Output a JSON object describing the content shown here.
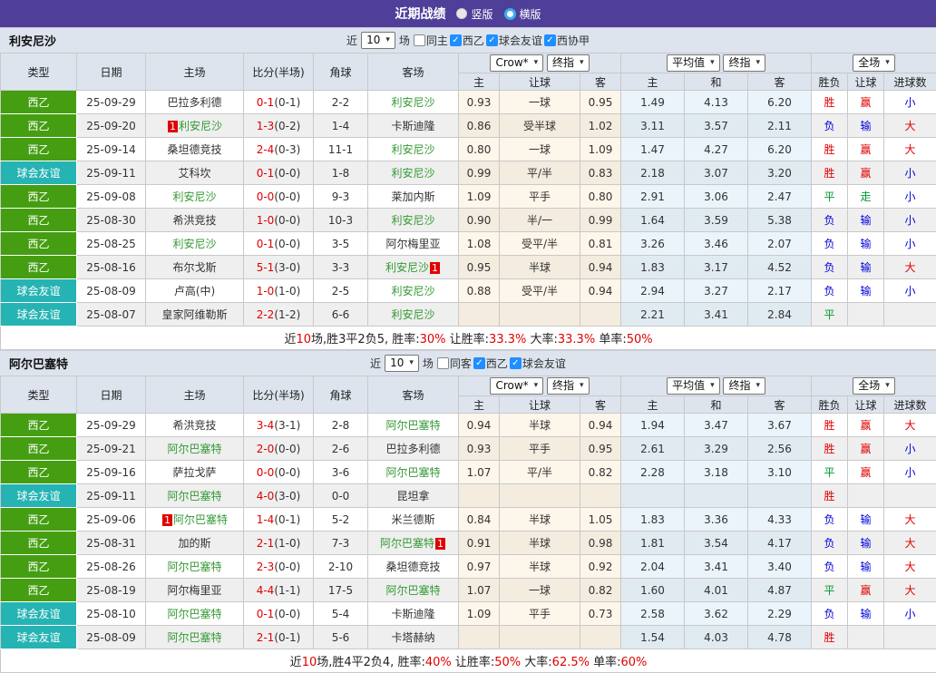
{
  "titlebar": {
    "title": "近期战绩",
    "layout_options": [
      {
        "label": "竖版",
        "style": "filled"
      },
      {
        "label": "横版",
        "style": "ring"
      }
    ]
  },
  "colors": {
    "header_purple": "#4f3f99",
    "league_green": "#459e12",
    "friendly_teal": "#26b3b3",
    "red": "#e00000",
    "blue": "#0000dd",
    "green": "#009933",
    "focus_team_green": "#339933"
  },
  "table_header": {
    "main_cols": [
      "类型",
      "日期",
      "主场",
      "比分(半场)",
      "角球",
      "客场"
    ],
    "odds_selects": [
      "Crow*",
      "终指"
    ],
    "avg_selects": [
      "平均值",
      "终指"
    ],
    "scope_select": "全场",
    "sub_cols": [
      "主",
      "让球",
      "客",
      "主",
      "和",
      "客",
      "胜负",
      "让球",
      "进球数"
    ]
  },
  "tables": [
    {
      "team": "利安尼沙",
      "filter": {
        "prefix": "近",
        "matches": "10",
        "suffix": "场",
        "same": {
          "label": "同主",
          "checked": false
        },
        "leagues": [
          {
            "label": "西乙",
            "checked": true
          },
          {
            "label": "球会友谊",
            "checked": true
          },
          {
            "label": "西协甲",
            "checked": true
          }
        ]
      },
      "rows": [
        {
          "type": "西乙",
          "tc": "g",
          "date": "25-09-29",
          "home": {
            "n": "巴拉多利德",
            "f": false
          },
          "score": "0-1",
          "half": "(0-1)",
          "corner": "2-2",
          "away": {
            "n": "利安尼沙",
            "f": true
          },
          "odds": [
            "0.93",
            "一球",
            "0.95"
          ],
          "avg": [
            "1.49",
            "4.13",
            "6.20"
          ],
          "res": [
            [
              "胜",
              "r"
            ],
            [
              "赢",
              "r"
            ],
            [
              "小",
              "b"
            ]
          ]
        },
        {
          "type": "西乙",
          "tc": "g",
          "date": "25-09-20",
          "home": {
            "n": "利安尼沙",
            "f": true,
            "pre": "1"
          },
          "score": "1-3",
          "half": "(0-2)",
          "corner": "1-4",
          "away": {
            "n": "卡斯迪隆",
            "f": false
          },
          "odds": [
            "0.86",
            "受半球",
            "1.02"
          ],
          "avg": [
            "3.11",
            "3.57",
            "2.11"
          ],
          "res": [
            [
              "负",
              "b"
            ],
            [
              "输",
              "b"
            ],
            [
              "大",
              "r"
            ]
          ]
        },
        {
          "type": "西乙",
          "tc": "g",
          "date": "25-09-14",
          "home": {
            "n": "桑坦德竞技",
            "f": false
          },
          "score": "2-4",
          "half": "(0-3)",
          "corner": "11-1",
          "away": {
            "n": "利安尼沙",
            "f": true
          },
          "odds": [
            "0.80",
            "一球",
            "1.09"
          ],
          "avg": [
            "1.47",
            "4.27",
            "6.20"
          ],
          "res": [
            [
              "胜",
              "r"
            ],
            [
              "赢",
              "r"
            ],
            [
              "大",
              "r"
            ]
          ]
        },
        {
          "type": "球会友谊",
          "tc": "t",
          "date": "25-09-11",
          "home": {
            "n": "艾科坎",
            "f": false
          },
          "score": "0-1",
          "half": "(0-0)",
          "corner": "1-8",
          "away": {
            "n": "利安尼沙",
            "f": true
          },
          "odds": [
            "0.99",
            "平/半",
            "0.83"
          ],
          "avg": [
            "2.18",
            "3.07",
            "3.20"
          ],
          "res": [
            [
              "胜",
              "r"
            ],
            [
              "赢",
              "r"
            ],
            [
              "小",
              "b"
            ]
          ]
        },
        {
          "type": "西乙",
          "tc": "g",
          "date": "25-09-08",
          "home": {
            "n": "利安尼沙",
            "f": true
          },
          "score": "0-0",
          "half": "(0-0)",
          "corner": "9-3",
          "away": {
            "n": "莱加内斯",
            "f": false
          },
          "odds": [
            "1.09",
            "平手",
            "0.80"
          ],
          "avg": [
            "2.91",
            "3.06",
            "2.47"
          ],
          "res": [
            [
              "平",
              "gr"
            ],
            [
              "走",
              "gr"
            ],
            [
              "小",
              "b"
            ]
          ]
        },
        {
          "type": "西乙",
          "tc": "g",
          "date": "25-08-30",
          "home": {
            "n": "希洪竞技",
            "f": false
          },
          "score": "1-0",
          "half": "(0-0)",
          "corner": "10-3",
          "away": {
            "n": "利安尼沙",
            "f": true
          },
          "odds": [
            "0.90",
            "半/一",
            "0.99"
          ],
          "avg": [
            "1.64",
            "3.59",
            "5.38"
          ],
          "res": [
            [
              "负",
              "b"
            ],
            [
              "输",
              "b"
            ],
            [
              "小",
              "b"
            ]
          ]
        },
        {
          "type": "西乙",
          "tc": "g",
          "date": "25-08-25",
          "home": {
            "n": "利安尼沙",
            "f": true
          },
          "score": "0-1",
          "half": "(0-0)",
          "corner": "3-5",
          "away": {
            "n": "阿尔梅里亚",
            "f": false
          },
          "odds": [
            "1.08",
            "受平/半",
            "0.81"
          ],
          "avg": [
            "3.26",
            "3.46",
            "2.07"
          ],
          "res": [
            [
              "负",
              "b"
            ],
            [
              "输",
              "b"
            ],
            [
              "小",
              "b"
            ]
          ]
        },
        {
          "type": "西乙",
          "tc": "g",
          "date": "25-08-16",
          "home": {
            "n": "布尔戈斯",
            "f": false
          },
          "score": "5-1",
          "half": "(3-0)",
          "corner": "3-3",
          "away": {
            "n": "利安尼沙",
            "f": true,
            "post": "1"
          },
          "odds": [
            "0.95",
            "半球",
            "0.94"
          ],
          "avg": [
            "1.83",
            "3.17",
            "4.52"
          ],
          "res": [
            [
              "负",
              "b"
            ],
            [
              "输",
              "b"
            ],
            [
              "大",
              "r"
            ]
          ]
        },
        {
          "type": "球会友谊",
          "tc": "t",
          "date": "25-08-09",
          "home": {
            "n": "卢高(中)",
            "f": false
          },
          "score": "1-0",
          "half": "(1-0)",
          "corner": "2-5",
          "away": {
            "n": "利安尼沙",
            "f": true
          },
          "odds": [
            "0.88",
            "受平/半",
            "0.94"
          ],
          "avg": [
            "2.94",
            "3.27",
            "2.17"
          ],
          "res": [
            [
              "负",
              "b"
            ],
            [
              "输",
              "b"
            ],
            [
              "小",
              "b"
            ]
          ]
        },
        {
          "type": "球会友谊",
          "tc": "t",
          "date": "25-08-07",
          "home": {
            "n": "皇家阿维勒斯",
            "f": false
          },
          "score": "2-2",
          "half": "(1-2)",
          "corner": "6-6",
          "away": {
            "n": "利安尼沙",
            "f": true
          },
          "odds": [
            "",
            "",
            ""
          ],
          "avg": [
            "2.21",
            "3.41",
            "2.84"
          ],
          "res": [
            [
              "平",
              "gr"
            ],
            [
              "",
              ""
            ],
            [
              "",
              ""
            ]
          ]
        }
      ],
      "summary": [
        {
          "t": "近",
          "r": false
        },
        {
          "t": "10",
          "r": true
        },
        {
          "t": "场,胜3平2负5, 胜率:",
          "r": false
        },
        {
          "t": "30%",
          "r": true
        },
        {
          "t": " 让胜率:",
          "r": false
        },
        {
          "t": "33.3%",
          "r": true
        },
        {
          "t": " 大率:",
          "r": false
        },
        {
          "t": "33.3%",
          "r": true
        },
        {
          "t": " 单率:",
          "r": false
        },
        {
          "t": "50%",
          "r": true
        }
      ]
    },
    {
      "team": "阿尔巴塞特",
      "filter": {
        "prefix": "近",
        "matches": "10",
        "suffix": "场",
        "same": {
          "label": "同客",
          "checked": false
        },
        "leagues": [
          {
            "label": "西乙",
            "checked": true
          },
          {
            "label": "球会友谊",
            "checked": true
          }
        ]
      },
      "rows": [
        {
          "type": "西乙",
          "tc": "g",
          "date": "25-09-29",
          "home": {
            "n": "希洪竞技",
            "f": false
          },
          "score": "3-4",
          "half": "(3-1)",
          "corner": "2-8",
          "away": {
            "n": "阿尔巴塞特",
            "f": true
          },
          "odds": [
            "0.94",
            "半球",
            "0.94"
          ],
          "avg": [
            "1.94",
            "3.47",
            "3.67"
          ],
          "res": [
            [
              "胜",
              "r"
            ],
            [
              "赢",
              "r"
            ],
            [
              "大",
              "r"
            ]
          ]
        },
        {
          "type": "西乙",
          "tc": "g",
          "date": "25-09-21",
          "home": {
            "n": "阿尔巴塞特",
            "f": true
          },
          "score": "2-0",
          "half": "(0-0)",
          "corner": "2-6",
          "away": {
            "n": "巴拉多利德",
            "f": false
          },
          "odds": [
            "0.93",
            "平手",
            "0.95"
          ],
          "avg": [
            "2.61",
            "3.29",
            "2.56"
          ],
          "res": [
            [
              "胜",
              "r"
            ],
            [
              "赢",
              "r"
            ],
            [
              "小",
              "b"
            ]
          ]
        },
        {
          "type": "西乙",
          "tc": "g",
          "date": "25-09-16",
          "home": {
            "n": "萨拉戈萨",
            "f": false
          },
          "score": "0-0",
          "half": "(0-0)",
          "corner": "3-6",
          "away": {
            "n": "阿尔巴塞特",
            "f": true
          },
          "odds": [
            "1.07",
            "平/半",
            "0.82"
          ],
          "avg": [
            "2.28",
            "3.18",
            "3.10"
          ],
          "res": [
            [
              "平",
              "gr"
            ],
            [
              "赢",
              "r"
            ],
            [
              "小",
              "b"
            ]
          ]
        },
        {
          "type": "球会友谊",
          "tc": "t",
          "date": "25-09-11",
          "home": {
            "n": "阿尔巴塞特",
            "f": true
          },
          "score": "4-0",
          "half": "(3-0)",
          "corner": "0-0",
          "away": {
            "n": "昆坦拿",
            "f": false
          },
          "odds": [
            "",
            "",
            ""
          ],
          "avg": [
            "",
            "",
            ""
          ],
          "res": [
            [
              "胜",
              "r"
            ],
            [
              "",
              ""
            ],
            [
              "",
              ""
            ]
          ]
        },
        {
          "type": "西乙",
          "tc": "g",
          "date": "25-09-06",
          "home": {
            "n": "阿尔巴塞特",
            "f": true,
            "pre": "1"
          },
          "score": "1-4",
          "half": "(0-1)",
          "corner": "5-2",
          "away": {
            "n": "米兰德斯",
            "f": false
          },
          "odds": [
            "0.84",
            "半球",
            "1.05"
          ],
          "avg": [
            "1.83",
            "3.36",
            "4.33"
          ],
          "res": [
            [
              "负",
              "b"
            ],
            [
              "输",
              "b"
            ],
            [
              "大",
              "r"
            ]
          ]
        },
        {
          "type": "西乙",
          "tc": "g",
          "date": "25-08-31",
          "home": {
            "n": "加的斯",
            "f": false
          },
          "score": "2-1",
          "half": "(1-0)",
          "corner": "7-3",
          "away": {
            "n": "阿尔巴塞特",
            "f": true,
            "post": "1"
          },
          "odds": [
            "0.91",
            "半球",
            "0.98"
          ],
          "avg": [
            "1.81",
            "3.54",
            "4.17"
          ],
          "res": [
            [
              "负",
              "b"
            ],
            [
              "输",
              "b"
            ],
            [
              "大",
              "r"
            ]
          ]
        },
        {
          "type": "西乙",
          "tc": "g",
          "date": "25-08-26",
          "home": {
            "n": "阿尔巴塞特",
            "f": true
          },
          "score": "2-3",
          "half": "(0-0)",
          "corner": "2-10",
          "away": {
            "n": "桑坦德竞技",
            "f": false
          },
          "odds": [
            "0.97",
            "半球",
            "0.92"
          ],
          "avg": [
            "2.04",
            "3.41",
            "3.40"
          ],
          "res": [
            [
              "负",
              "b"
            ],
            [
              "输",
              "b"
            ],
            [
              "大",
              "r"
            ]
          ]
        },
        {
          "type": "西乙",
          "tc": "g",
          "date": "25-08-19",
          "home": {
            "n": "阿尔梅里亚",
            "f": false
          },
          "score": "4-4",
          "half": "(1-1)",
          "corner": "17-5",
          "away": {
            "n": "阿尔巴塞特",
            "f": true
          },
          "odds": [
            "1.07",
            "一球",
            "0.82"
          ],
          "avg": [
            "1.60",
            "4.01",
            "4.87"
          ],
          "res": [
            [
              "平",
              "gr"
            ],
            [
              "赢",
              "r"
            ],
            [
              "大",
              "r"
            ]
          ]
        },
        {
          "type": "球会友谊",
          "tc": "t",
          "date": "25-08-10",
          "home": {
            "n": "阿尔巴塞特",
            "f": true
          },
          "score": "0-1",
          "half": "(0-0)",
          "corner": "5-4",
          "away": {
            "n": "卡斯迪隆",
            "f": false
          },
          "odds": [
            "1.09",
            "平手",
            "0.73"
          ],
          "avg": [
            "2.58",
            "3.62",
            "2.29"
          ],
          "res": [
            [
              "负",
              "b"
            ],
            [
              "输",
              "b"
            ],
            [
              "小",
              "b"
            ]
          ]
        },
        {
          "type": "球会友谊",
          "tc": "t",
          "date": "25-08-09",
          "home": {
            "n": "阿尔巴塞特",
            "f": true
          },
          "score": "2-1",
          "half": "(0-1)",
          "corner": "5-6",
          "away": {
            "n": "卡塔赫纳",
            "f": false
          },
          "odds": [
            "",
            "",
            ""
          ],
          "avg": [
            "1.54",
            "4.03",
            "4.78"
          ],
          "res": [
            [
              "胜",
              "r"
            ],
            [
              "",
              ""
            ],
            [
              "",
              ""
            ]
          ]
        }
      ],
      "summary": [
        {
          "t": "近",
          "r": false
        },
        {
          "t": "10",
          "r": true
        },
        {
          "t": "场,胜4平2负4, 胜率:",
          "r": false
        },
        {
          "t": "40%",
          "r": true
        },
        {
          "t": " 让胜率:",
          "r": false
        },
        {
          "t": "50%",
          "r": true
        },
        {
          "t": " 大率:",
          "r": false
        },
        {
          "t": "62.5%",
          "r": true
        },
        {
          "t": " 单率:",
          "r": false
        },
        {
          "t": "60%",
          "r": true
        }
      ]
    }
  ]
}
